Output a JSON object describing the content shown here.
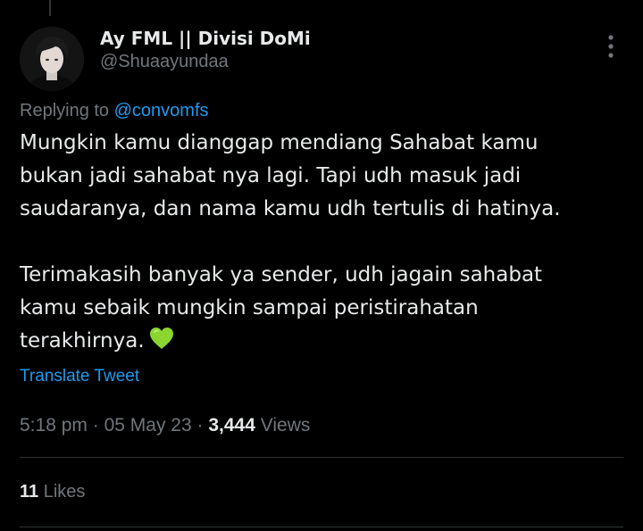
{
  "tweet": {
    "author": {
      "display_name": "Ay FML || Divisi DoMi",
      "handle": "@Shuaayundaa"
    },
    "replying_prefix": "Replying to",
    "replying_to": "@convomfs",
    "body": {
      "paragraph1": "Mungkin kamu dianggap mendiang Sahabat kamu\nbukan jadi sahabat nya lagi. Tapi udh masuk jadi\nsaudaranya, dan nama kamu udh tertulis di hatinya.",
      "paragraph2": "Terimakasih banyak ya sender, udh jagain sahabat\nkamu sebaik mungkin sampai peristirahatan\nterakhirnya."
    },
    "emoji_icon": "green-heart-icon",
    "translate_label": "Translate Tweet",
    "time": "5:18 pm",
    "date": "05 May 23",
    "separator": "·",
    "views_count": "3,444",
    "views_label": "Views",
    "likes_count": "11",
    "likes_label": "Likes"
  },
  "colors": {
    "background": "#000000",
    "text_primary": "#e7e9ea",
    "text_secondary": "#71767b",
    "accent": "#1d9bf0",
    "heart": "#8bd62e"
  }
}
